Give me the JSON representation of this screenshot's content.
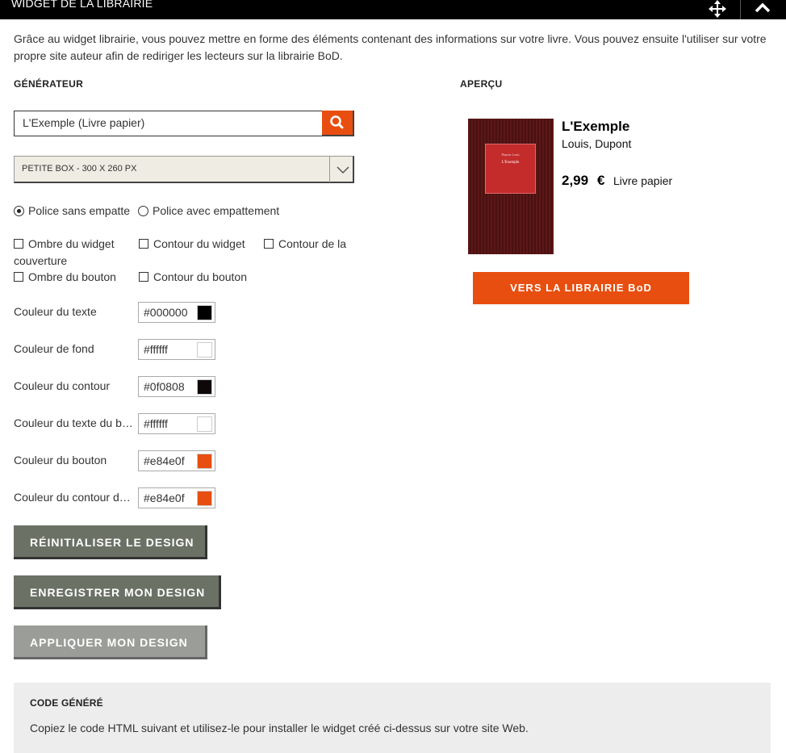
{
  "header": {
    "title": "WIDGET DE LA LIBRAIRIE",
    "move_icon": "move-arrows-icon",
    "collapse_icon": "chevron-up-icon"
  },
  "intro": "Grâce au widget librairie, vous pouvez mettre en forme des éléments contenant des informations sur votre livre. Vous pouvez ensuite l'utiliser sur votre propre site auteur afin de rediriger les lecteurs sur la librairie BoD.",
  "generator": {
    "label": "GÉNÉRATEUR",
    "search_value": "L'Exemple (Livre papier)",
    "search_icon": "search-icon",
    "size_select": "PETITE BOX - 300 X 260 PX",
    "font_options": [
      {
        "label": "Police sans empatte",
        "checked": true
      },
      {
        "label": "Police avec empattement",
        "checked": false
      }
    ],
    "checkboxes": {
      "widget_shadow": "Ombre du widget",
      "widget_border": "Contour du widget",
      "cover_border_line1": "Contour de la",
      "cover_border_line2": "couverture",
      "button_shadow": "Ombre du bouton",
      "button_border": "Contour du bouton"
    },
    "colors": [
      {
        "label": "Couleur du texte",
        "value": "#000000",
        "swatch": "#000000"
      },
      {
        "label": "Couleur de fond",
        "value": "#ffffff",
        "swatch": "#ffffff"
      },
      {
        "label": "Couleur du contour",
        "value": "#0f0808",
        "swatch": "#0f0808"
      },
      {
        "label": "Couleur du texte du bouton",
        "value": "#ffffff",
        "swatch": "#ffffff"
      },
      {
        "label": "Couleur du bouton",
        "value": "#e84e0f",
        "swatch": "#e84e0f"
      },
      {
        "label": "Couleur du contour du bouton",
        "value": "#e84e0f",
        "swatch": "#e84e0f"
      }
    ],
    "buttons": {
      "reset": "RÉINITIALISER LE DESIGN",
      "save": "ENREGISTRER MON DESIGN",
      "apply": "APPLIQUER MON DESIGN"
    }
  },
  "preview": {
    "label": "APERÇU",
    "cover_author": "Dupont Louis",
    "cover_title": "L'Exemple",
    "title": "L'Exemple",
    "author": "Louis, Dupont",
    "price": "2,99",
    "currency": "€",
    "format": "Livre papier",
    "cta": "VERS LA LIBRAIRIE BoD"
  },
  "code": {
    "label": "CODE GÉNÉRÉ",
    "text": "Copiez le code HTML suivant et utilisez-le pour installer le widget créé ci-dessus sur votre site Web."
  },
  "accent": "#e84e0f"
}
